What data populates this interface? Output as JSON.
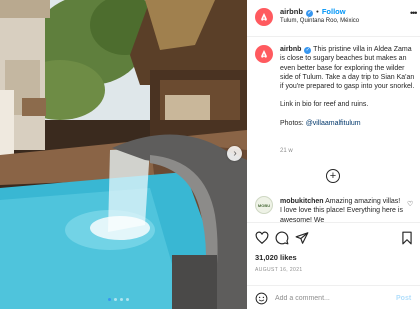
{
  "post": {
    "image_alt": "Villa pool with waterfall fountain",
    "carousel": {
      "slide_count": 4,
      "active_slide": 1
    }
  },
  "header": {
    "username": "airbnb",
    "separator": "•",
    "follow_label": "Follow",
    "location": "Tulum, Quintana Roo, México",
    "verified_icon": "verified-badge-icon",
    "more_icon": "more-options-icon"
  },
  "caption": {
    "username": "airbnb",
    "text": "This pristine villa in Aldea Zama is close to sugary beaches but makes an even better base for exploring the wilder side of Tulum. Take a day trip to Sian Ka'an if you're prepared to gasp into your snorkel.",
    "line2": "Link in bio for reef and ruins.",
    "photos_prefix": "Photos: ",
    "photos_tag": "@villaamalfitulum",
    "time": "21 w"
  },
  "comment": {
    "username": "mobukitchen",
    "text": "Amazing amazing villas! I love love this place! Everything here is awesome! We",
    "avatar_text": "MOBU"
  },
  "actions": {
    "likes": "31,020 likes",
    "date": "AUGUST 16, 2021"
  },
  "add_comment": {
    "placeholder": "Add a comment...",
    "post_label": "Post"
  },
  "colors": {
    "brand": "#FF5A5F",
    "link": "#0095F6",
    "verified": "#3897F0"
  }
}
